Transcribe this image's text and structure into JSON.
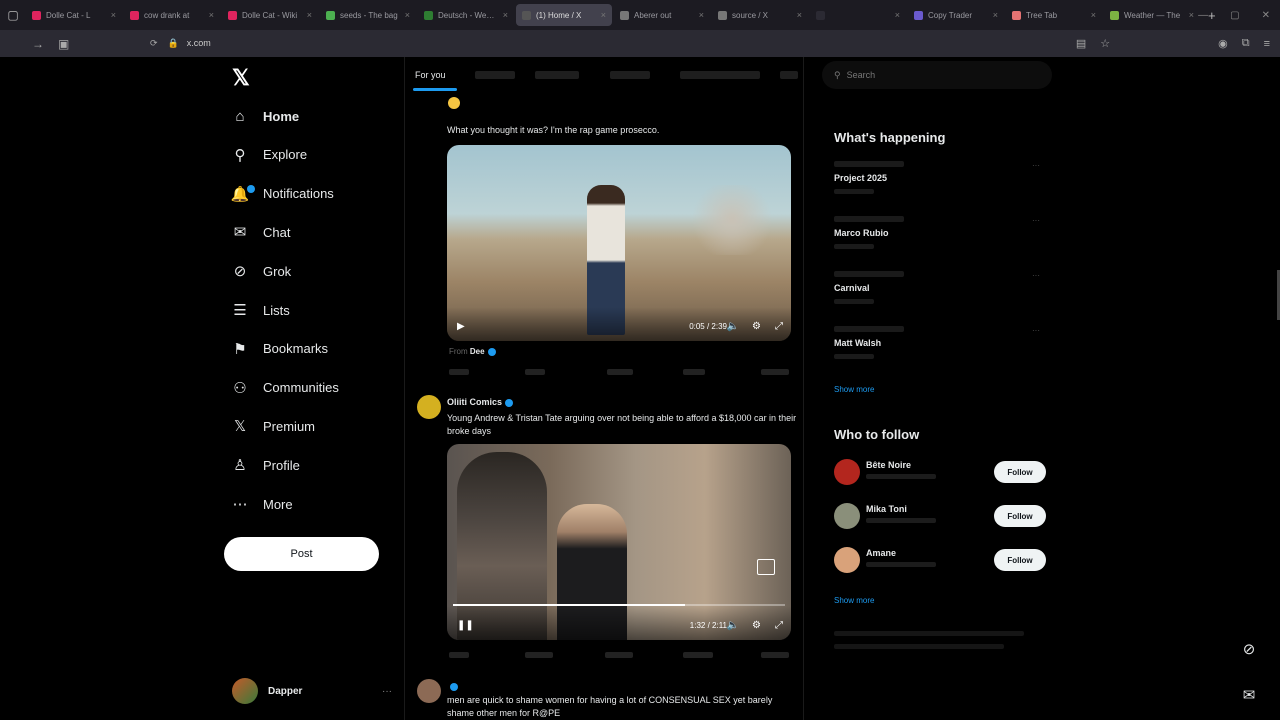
{
  "browser": {
    "tabs": [
      {
        "label": "Dolle Cat - L",
        "color": "#e0245e"
      },
      {
        "label": "cow drank at",
        "color": "#e0245e"
      },
      {
        "label": "Dolle Cat - Wiki",
        "color": "#e0245e"
      },
      {
        "label": "seeds - The bag",
        "color": "#4caf50"
      },
      {
        "label": "Deutsch - Website",
        "color": "#2e7d32"
      },
      {
        "label": "(1) Home / X",
        "color": "#555555",
        "active": true
      },
      {
        "label": "Aberer out",
        "color": "#777777"
      },
      {
        "label": "source / X",
        "color": "#777777"
      },
      {
        "label": "",
        "color": "#2b2a33"
      },
      {
        "label": "Copy Trader",
        "color": "#6a5acd"
      },
      {
        "label": "Tree Tab",
        "color": "#e57373"
      },
      {
        "label": "Weather — The",
        "color": "#7cb342"
      }
    ],
    "url": "x.com",
    "new_tab": "+",
    "tab_close": "×"
  },
  "nav": {
    "items": [
      {
        "id": "home",
        "label": "Home",
        "icon": "⌂",
        "bold": true
      },
      {
        "id": "explore",
        "label": "Explore",
        "icon": "⚲"
      },
      {
        "id": "notifications",
        "label": "Notifications",
        "icon": "🔔"
      },
      {
        "id": "chat",
        "label": "Chat",
        "icon": "✉"
      },
      {
        "id": "grok",
        "label": "Grok",
        "icon": "⊘"
      },
      {
        "id": "lists",
        "label": "Lists",
        "icon": "☰"
      },
      {
        "id": "bookmarks",
        "label": "Bookmarks",
        "icon": "⚑"
      },
      {
        "id": "communities",
        "label": "Communities",
        "icon": "⚇"
      },
      {
        "id": "premium",
        "label": "Premium",
        "icon": "𝕏"
      },
      {
        "id": "profile",
        "label": "Profile",
        "icon": "♙"
      },
      {
        "id": "more",
        "label": "More",
        "icon": "⋯"
      }
    ],
    "post_label": "Post",
    "account_name": "Dapper",
    "account_more": "···"
  },
  "feed": {
    "tab_for_you": "For you",
    "post1": {
      "quote": "What you thought it was? I'm the rap game prosecco.",
      "video_time": "0:05 / 2:39",
      "source_name": "Dee"
    },
    "post2": {
      "name": "Oliiti Comics",
      "text": "Young Andrew & Tristan Tate arguing over not being able to afford a $18,000 car in their broke days",
      "video_time": "1:32 / 2:11",
      "progress": 0.7
    },
    "post3": {
      "text": "men are quick to shame women for having a lot of CONSENSUAL SEX yet barely shame other men for R@PE"
    }
  },
  "right": {
    "search_placeholder": "Search",
    "whats_happening": "What's happening",
    "trends": [
      {
        "name": "Project 2025"
      },
      {
        "name": "Marco Rubio"
      },
      {
        "name": "Carnival"
      },
      {
        "name": "Matt Walsh"
      }
    ],
    "trend_more": "···",
    "show_more": "Show more",
    "who_to_follow": "Who to follow",
    "follow": [
      {
        "name": "Bête Noire",
        "avatar": "#b3261e"
      },
      {
        "name": "Mika Toni",
        "avatar": "#8a8f7a"
      },
      {
        "name": "Amane",
        "avatar": "#d9a27a"
      }
    ],
    "follow_label": "Follow",
    "follow_more": "Show more"
  },
  "float": {
    "grok_icon": "⊘",
    "messages_icon": "✉"
  }
}
